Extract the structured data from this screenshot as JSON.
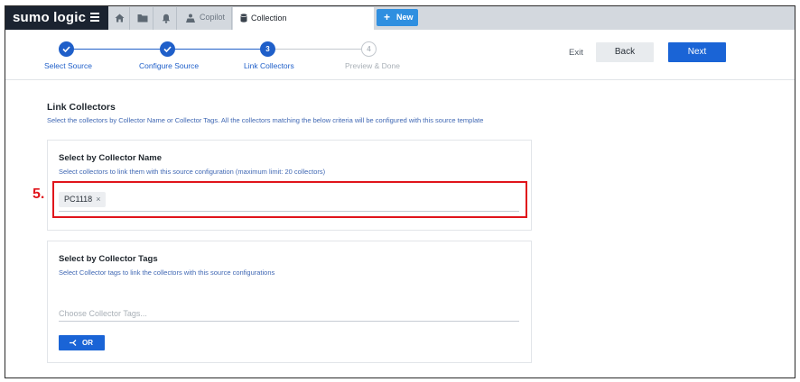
{
  "app": {
    "logo_text": "sumo logic"
  },
  "tabs": {
    "copilot_label": "Copilot",
    "collection_label": "Collection",
    "new_label": "New"
  },
  "wizard": {
    "steps": [
      {
        "number": "1",
        "label": "Select Source",
        "state": "complete"
      },
      {
        "number": "2",
        "label": "Configure Source",
        "state": "complete"
      },
      {
        "number": "3",
        "label": "Link Collectors",
        "state": "active"
      },
      {
        "number": "4",
        "label": "Preview & Done",
        "state": "pending"
      }
    ],
    "exit_label": "Exit",
    "back_label": "Back",
    "next_label": "Next"
  },
  "link_collectors": {
    "title": "Link Collectors",
    "description": "Select the collectors by Collector Name or Collector Tags. All the collectors matching the below criteria will be configured with this source template"
  },
  "by_name": {
    "title": "Select by Collector Name",
    "subtitle": "Select collectors to link them with this source configuration (maximum limit: 20 collectors)",
    "selected": [
      "PC1118"
    ]
  },
  "by_tags": {
    "title": "Select by Collector Tags",
    "subtitle": "Select Collector tags to link the collectors with this source configurations",
    "placeholder": "Choose Collector Tags...",
    "or_label": "OR"
  },
  "annotation": {
    "label": "5.",
    "color": "#e0141b"
  },
  "colors": {
    "brand_dark": "#1b2330",
    "accent": "#1a64d6",
    "link_text": "#3f67b3"
  }
}
